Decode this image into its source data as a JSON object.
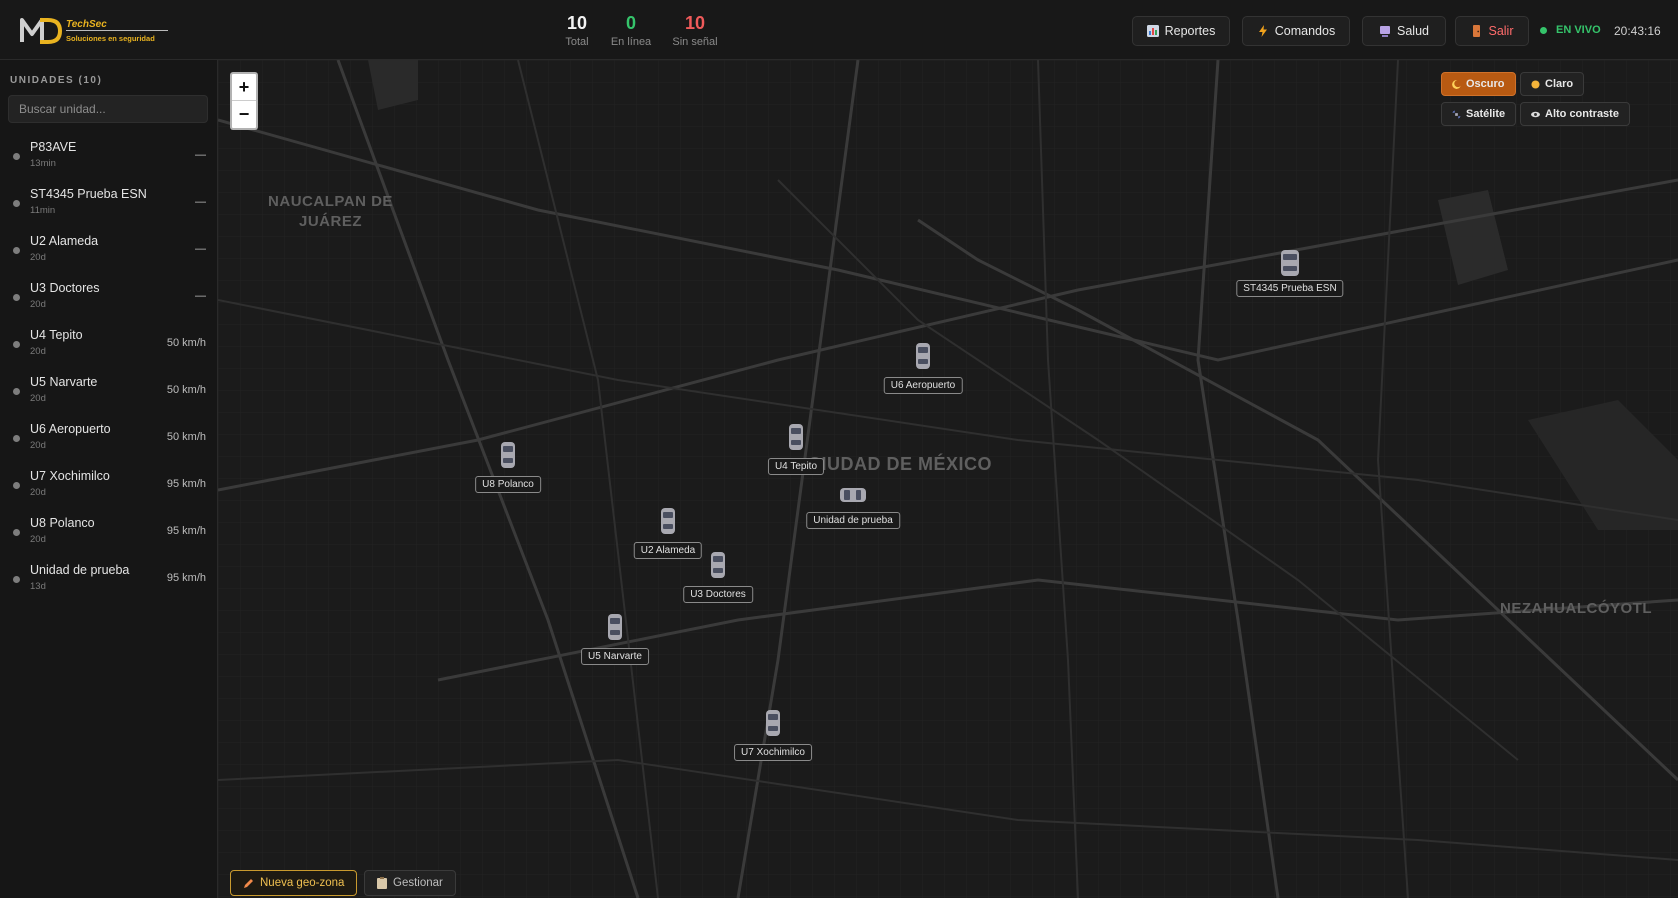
{
  "brand": {
    "name": "TechSec",
    "tagline": "Soluciones en seguridad",
    "logo_letters": "MD",
    "accent_color": "#e9b320"
  },
  "stats": {
    "total": {
      "value": "10",
      "label": "Total"
    },
    "online": {
      "value": "0",
      "label": "En línea"
    },
    "offline": {
      "value": "10",
      "label": "Sin señal"
    }
  },
  "toolbar": {
    "reportes": {
      "label": "Reportes",
      "icon": "bar-chart-icon"
    },
    "comandos": {
      "label": "Comandos",
      "icon": "lightning-icon"
    },
    "salud": {
      "label": "Salud",
      "icon": "monitor-icon"
    },
    "salir": {
      "label": "Salir",
      "icon": "door-icon"
    },
    "live": "EN VIVO",
    "clock": "20:43:16"
  },
  "sidebar": {
    "title": "UNIDADES (10)",
    "search_placeholder": "Buscar unidad...",
    "units": [
      {
        "name": "P83AVE",
        "ago": "13min",
        "speed": "—"
      },
      {
        "name": "ST4345 Prueba ESN",
        "ago": "11min",
        "speed": "—"
      },
      {
        "name": "U2 Alameda",
        "ago": "20d",
        "speed": "—"
      },
      {
        "name": "U3 Doctores",
        "ago": "20d",
        "speed": "—"
      },
      {
        "name": "U4 Tepito",
        "ago": "20d",
        "speed": "50 km/h"
      },
      {
        "name": "U5 Narvarte",
        "ago": "20d",
        "speed": "50 km/h"
      },
      {
        "name": "U6 Aeropuerto",
        "ago": "20d",
        "speed": "50 km/h"
      },
      {
        "name": "U7 Xochimilco",
        "ago": "20d",
        "speed": "95 km/h"
      },
      {
        "name": "U8 Polanco",
        "ago": "20d",
        "speed": "95 km/h"
      },
      {
        "name": "Unidad de prueba",
        "ago": "13d",
        "speed": "95 km/h"
      }
    ]
  },
  "map": {
    "zoom_in": "+",
    "zoom_out": "−",
    "places": {
      "naucalpan": "NAUCALPAN DE JUÁREZ",
      "cdmx": "CIUDAD DE MÉXICO",
      "neza": "NEZAHUALCÓYOTL"
    },
    "layers": {
      "oscuro": {
        "label": "Oscuro",
        "icon": "moon-icon"
      },
      "claro": {
        "label": "Claro",
        "icon": "sun-icon"
      },
      "satelite": {
        "label": "Satélite",
        "icon": "satellite-icon"
      },
      "alto": {
        "label": "Alto contraste",
        "icon": "eye-icon"
      }
    },
    "vehicle_labels": {
      "st4345": "ST4345 Prueba ESN",
      "u6": "U6 Aeropuerto",
      "u4": "U4 Tepito",
      "u8": "U8 Polanco",
      "prueba": "Unidad de prueba",
      "u2": "U2 Alameda",
      "u3": "U3 Doctores",
      "u5": "U5 Narvarte",
      "u7": "U7 Xochimilco"
    },
    "actions": {
      "geo": {
        "label": "Nueva geo-zona",
        "icon": "pencil-icon"
      },
      "gest": {
        "label": "Gestionar",
        "icon": "clipboard-icon"
      }
    }
  }
}
